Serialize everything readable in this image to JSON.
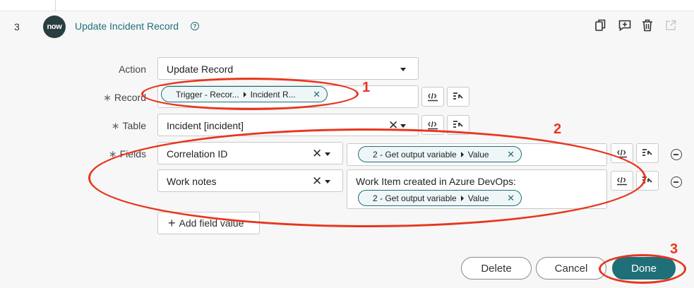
{
  "step": {
    "number": "3",
    "logo_text": "now",
    "title": "Update Incident Record",
    "help_glyph": "?"
  },
  "toolbar": {
    "icons": [
      "copy-icon",
      "comment-add-icon",
      "trash-icon",
      "open-external-icon"
    ]
  },
  "form": {
    "action": {
      "label": "Action",
      "value": "Update Record"
    },
    "record": {
      "label": "Record",
      "required_mark": "∗",
      "pill_left": "Trigger - Recor...",
      "pill_right": "Incident R..."
    },
    "table": {
      "label": "Table",
      "required_mark": "∗",
      "value": "Incident [incident]"
    },
    "fields": {
      "label": "Fields",
      "required_mark": "∗",
      "rows": [
        {
          "field": "Correlation ID",
          "value_text": "",
          "pill_left": "2 - Get output variable",
          "pill_right": "Value"
        },
        {
          "field": "Work notes",
          "value_text": "Work Item created in Azure DevOps:",
          "pill_left": "2 - Get output variable",
          "pill_right": "Value"
        }
      ],
      "add_label": "Add field value",
      "add_glyph": "+"
    }
  },
  "buttons": {
    "delete": "Delete",
    "cancel": "Cancel",
    "done": "Done"
  },
  "annotations": {
    "one": "1",
    "two": "2",
    "three": "3",
    "color": "#e8361e"
  },
  "colors": {
    "accent": "#1f6f78",
    "logo_bg": "#293e40"
  }
}
